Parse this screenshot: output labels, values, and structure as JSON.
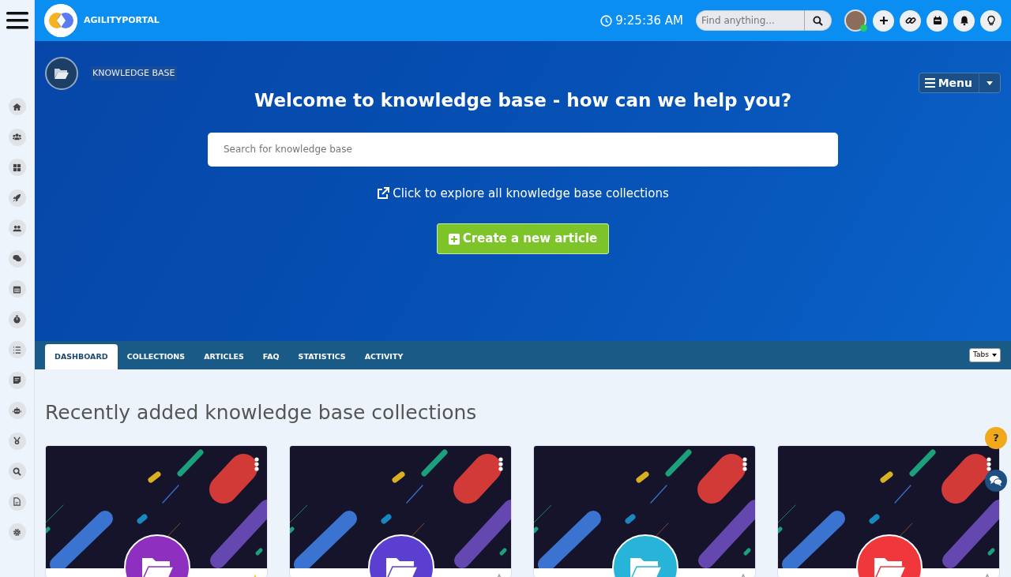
{
  "top_bar": {
    "brand": "AGILITYPORTAL",
    "time": "9:25:36 AM",
    "search": {
      "placeholder": "Find anything..."
    },
    "user": {
      "online": true
    }
  },
  "header": {
    "section": "KNOWLEDGE BASE",
    "menu_button": "Menu"
  },
  "hero": {
    "title": "Welcome to knowledge base - how can we help you?",
    "search": {
      "placeholder": "Search for knowledge base"
    },
    "explore_link": "Click to explore all knowledge base collections",
    "create_button": "Create a new article"
  },
  "tabs": [
    {
      "label": "DASHBOARD",
      "selected": true
    },
    {
      "label": "COLLECTIONS",
      "selected": false
    },
    {
      "label": "ARTICLES",
      "selected": false
    },
    {
      "label": "FAQ",
      "selected": false
    },
    {
      "label": "STATISTICS",
      "selected": false
    },
    {
      "label": "ACTIVITY",
      "selected": false
    }
  ],
  "tabs_menu": "Tabs",
  "section_title": "Recently added knowledge base collections",
  "collections": [
    {
      "color": "#8e2fc0",
      "favorite": true
    },
    {
      "color": "#5a3fd0",
      "favorite": false
    },
    {
      "color": "#27b4d8",
      "favorite": false
    },
    {
      "color": "#f0383c",
      "favorite": false
    }
  ],
  "help_button": "?"
}
